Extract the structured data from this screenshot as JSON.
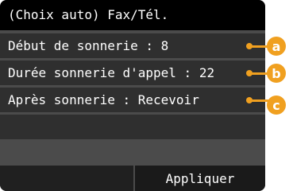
{
  "header": {
    "title": "(Choix auto) Fax/Tél."
  },
  "settings": [
    {
      "label": "Début de sonnerie :  8",
      "marker": "a"
    },
    {
      "label": "Durée sonnerie d'appel : 22",
      "marker": "b"
    },
    {
      "label": "Après sonnerie : Recevoir",
      "marker": "c"
    }
  ],
  "footer": {
    "apply_label": "Appliquer"
  },
  "colors": {
    "accent": "#f0a020",
    "title_bar": "#000000",
    "row": "#2f2f2f"
  }
}
